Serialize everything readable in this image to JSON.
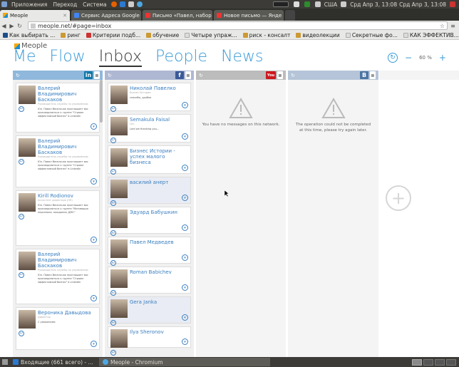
{
  "top_panel": {
    "menus": [
      "Приложения",
      "Переход",
      "Система"
    ],
    "tray": {
      "keyboard": "США",
      "clock_1": "Срд Апр 3, 13:08",
      "clock_2": "Срд Апр 3, 13:08"
    }
  },
  "browser": {
    "tabs": [
      {
        "label": "Meople",
        "active": false
      },
      {
        "label": "Сервис Адреса Google",
        "active": false
      },
      {
        "label": "Письмо «Павел, набор",
        "active": false
      },
      {
        "label": "Новое письмо — Янде",
        "active": false
      }
    ],
    "url": "meople.net/#page=inbox",
    "bookmarks": [
      "Как выбирать ...",
      "ринг",
      "Критерии подб...",
      "обучение",
      "Четыре упраж...",
      "риск - консалт",
      "видеолекции",
      "Секретные фо...",
      "КАК ЭФФЕКТИВ..."
    ]
  },
  "app": {
    "logo": "Meople",
    "nav": [
      "Me",
      "Flow",
      "Inbox",
      "People",
      "News"
    ],
    "selected_nav": "Inbox",
    "zoom": "60 %",
    "zoom_minus": "−",
    "zoom_plus": "+",
    "add_column": "+"
  },
  "columns": {
    "linkedin": {
      "network": "in",
      "color": "#0e76a8",
      "cards": [
        {
          "name": "Валерий Владимирович Баскаков",
          "sub": "Руководитель службы по управлению",
          "text": "Юл. Павел Весельчак приглашает вас присоединиться к группе \"Строим эффективный бизнес\" в LinkedIn"
        },
        {
          "name": "Валерий Владимирович Баскаков",
          "sub": "Руководитель службы по управлению",
          "text": "Юл. Павел Весельчак приглашает вас присоединиться к группе \"Строим эффективный бизнес\" в LinkedIn"
        },
        {
          "name": "Kirill Rodionov",
          "sub": "Ассистент директора (HR)",
          "text": "Юл. Павел Весельчак приглашает вас присоединиться к группе \"Мотивация персонала, ожидания, ДМС\""
        },
        {
          "name": "Валерий Владимирович Баскаков",
          "sub": "Руководитель службы по управлению",
          "text": "Юл. Павел Весельчак приглашает вас присоединиться к группе \"Строим эффективный бизнес\" в LinkedIn"
        },
        {
          "name": "Вероника Давыдова",
          "sub": "Директор",
          "text": "С уважением"
        }
      ]
    },
    "facebook": {
      "network": "f",
      "color": "#3b5998",
      "cards": [
        {
          "name": "Николай Павелко",
          "sub": "Бизнес Истории",
          "text": "спасибо, удобно",
          "hl": false
        },
        {
          "name": "Semakula Faisal",
          "sub": "Ltd.",
          "text": "Lord we thanking you...",
          "hl": false
        },
        {
          "name": "Бизнес Истории - успех малого бизнеса",
          "sub": "",
          "text": "",
          "hl": false
        },
        {
          "name": "василий анерт",
          "sub": "",
          "text": "",
          "hl": true
        },
        {
          "name": "Эдуард Бабушкин",
          "sub": "",
          "text": "",
          "hl": false
        },
        {
          "name": "Павел Медведев",
          "sub": "",
          "text": "",
          "hl": false
        },
        {
          "name": "Roman Babichev",
          "sub": "",
          "text": "",
          "hl": false
        },
        {
          "name": "Gera Janka",
          "sub": "",
          "text": "",
          "hl": true
        },
        {
          "name": "Ilya Sheronov",
          "sub": "",
          "text": "",
          "hl": false
        }
      ]
    },
    "youtube": {
      "network": "You",
      "color": "#cc181e",
      "message": "You have no messages on this network."
    },
    "vkontakte": {
      "network": "B",
      "color": "#4c75a3",
      "message": "The operation could not be completed at this time, please try again later."
    }
  },
  "taskbar": {
    "items": [
      {
        "label": "Входящие (661 всего) - ...",
        "active": false
      },
      {
        "label": "Meople - Chromium",
        "active": true
      }
    ]
  }
}
